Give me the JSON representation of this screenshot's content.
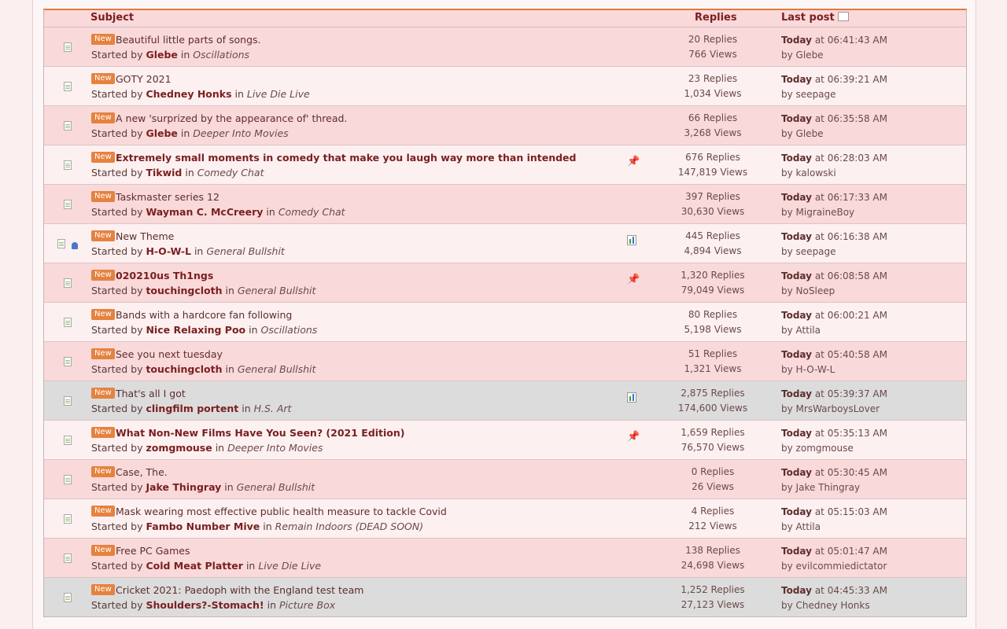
{
  "header": {
    "subject": "Subject",
    "replies": "Replies",
    "last_post": "Last post",
    "sort_icon": "sort-icon"
  },
  "labels": {
    "new_badge": "New",
    "started_by": "Started by",
    "in": "in",
    "at": "at",
    "by": "by"
  },
  "topics": [
    {
      "title": "Beautiful little parts of songs.",
      "author": "Glebe",
      "board": "Oscillations",
      "replies": "20 Replies",
      "views": "766 Views",
      "day": "Today",
      "time": "06:41:43 AM",
      "last_by": "Glebe",
      "style": "odd",
      "bold": false,
      "marker": ""
    },
    {
      "title": "GOTY 2021",
      "author": "Chedney Honks",
      "board": "Live Die Live",
      "replies": "23 Replies",
      "views": "1,034 Views",
      "day": "Today",
      "time": "06:39:21 AM",
      "last_by": "seepage",
      "style": "even",
      "bold": false,
      "marker": ""
    },
    {
      "title": "A new 'surprized by the appearance of' thread.",
      "author": "Glebe",
      "board": "Deeper Into Movies",
      "replies": "66 Replies",
      "views": "3,268 Views",
      "day": "Today",
      "time": "06:35:58 AM",
      "last_by": "Glebe",
      "style": "odd",
      "bold": false,
      "marker": ""
    },
    {
      "title": "Extremely small moments in comedy that make you laugh way more than intended",
      "author": "Tikwid",
      "board": "Comedy Chat",
      "replies": "676 Replies",
      "views": "147,819 Views",
      "day": "Today",
      "time": "06:28:03 AM",
      "last_by": "kalowski",
      "style": "even",
      "bold": true,
      "marker": "pin"
    },
    {
      "title": "Taskmaster series 12",
      "author": "Wayman C. McCreery",
      "board": "Comedy Chat",
      "replies": "397 Replies",
      "views": "30,630 Views",
      "day": "Today",
      "time": "06:17:33 AM",
      "last_by": "MigraineBoy",
      "style": "odd",
      "bold": false,
      "marker": ""
    },
    {
      "title": "New Theme",
      "author": "H-O-W-L",
      "board": "General Bullshit",
      "replies": "445 Replies",
      "views": "4,894 Views",
      "day": "Today",
      "time": "06:16:38 AM",
      "last_by": "seepage",
      "style": "even",
      "bold": false,
      "marker": "poll",
      "own": true
    },
    {
      "title": "020210us Th1ngs",
      "author": "touchingcloth",
      "board": "General Bullshit",
      "replies": "1,320 Replies",
      "views": "79,049 Views",
      "day": "Today",
      "time": "06:08:58 AM",
      "last_by": "NoSleep",
      "style": "odd",
      "bold": true,
      "marker": "pin"
    },
    {
      "title": "Bands with a hardcore fan following",
      "author": "Nice Relaxing Poo",
      "board": "Oscillations",
      "replies": "80 Replies",
      "views": "5,198 Views",
      "day": "Today",
      "time": "06:00:21 AM",
      "last_by": "Attila",
      "style": "even",
      "bold": false,
      "marker": ""
    },
    {
      "title": "See you next tuesday",
      "author": "touchingcloth",
      "board": "General Bullshit",
      "replies": "51 Replies",
      "views": "1,321 Views",
      "day": "Today",
      "time": "05:40:58 AM",
      "last_by": "H-O-W-L",
      "style": "odd",
      "bold": false,
      "marker": ""
    },
    {
      "title": "That's all I got",
      "author": "clingfilm portent",
      "board": "H.S. Art",
      "replies": "2,875 Replies",
      "views": "174,600 Views",
      "day": "Today",
      "time": "05:39:37 AM",
      "last_by": "MrsWarboysLover",
      "style": "sticky",
      "bold": false,
      "marker": "poll"
    },
    {
      "title": "What Non-New Films Have You Seen? (2021 Edition)",
      "author": "zomgmouse",
      "board": "Deeper Into Movies",
      "replies": "1,659 Replies",
      "views": "76,570 Views",
      "day": "Today",
      "time": "05:35:13 AM",
      "last_by": "zomgmouse",
      "style": "even",
      "bold": true,
      "marker": "pin"
    },
    {
      "title": "Case, The.",
      "author": "Jake Thingray",
      "board": "General Bullshit",
      "replies": "0 Replies",
      "views": "26 Views",
      "day": "Today",
      "time": "05:30:45 AM",
      "last_by": "Jake Thingray",
      "style": "odd",
      "bold": false,
      "marker": ""
    },
    {
      "title": "Mask wearing most effective public health measure to tackle Covid",
      "author": "Fambo Number Mive",
      "board": "Remain Indoors (DEAD SOON)",
      "replies": "4 Replies",
      "views": "212 Views",
      "day": "Today",
      "time": "05:15:03 AM",
      "last_by": "Attila",
      "style": "even",
      "bold": false,
      "marker": ""
    },
    {
      "title": "Free PC Games",
      "author": "Cold Meat Platter",
      "board": "Live Die Live",
      "replies": "138 Replies",
      "views": "24,698 Views",
      "day": "Today",
      "time": "05:01:47 AM",
      "last_by": "evilcommiedictator",
      "style": "odd",
      "bold": false,
      "marker": ""
    },
    {
      "title": "Cricket 2021: Paedoph with the England test team",
      "author": "Shoulders?-Stomach!",
      "board": "Picture Box",
      "replies": "1,252 Replies",
      "views": "27,123 Views",
      "day": "Today",
      "time": "04:45:33 AM",
      "last_by": "Chedney Honks",
      "style": "sticky",
      "bold": false,
      "marker": ""
    }
  ]
}
